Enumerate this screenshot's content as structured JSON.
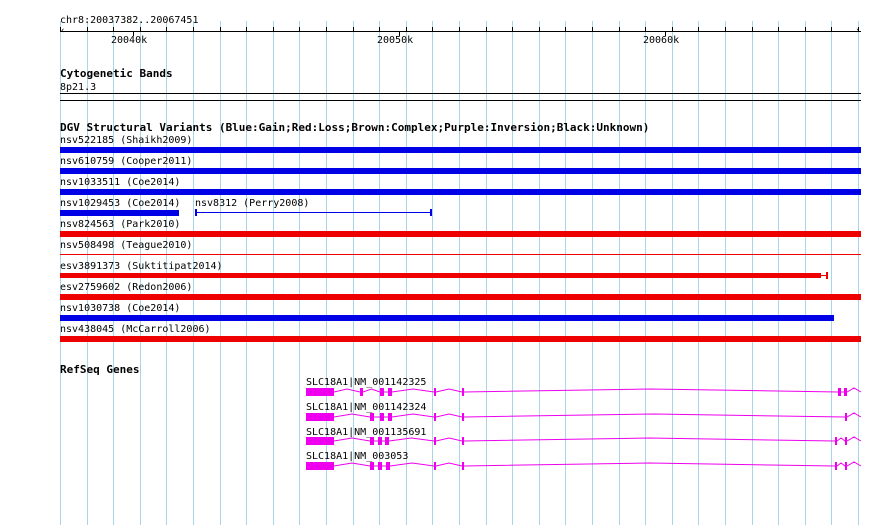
{
  "ruler": {
    "position": "chr8:20037382..20067451",
    "ticks": [
      "20040k",
      "20050k",
      "20060k"
    ]
  },
  "cytobands": {
    "title": "Cytogenetic Bands",
    "band": "8p21.3"
  },
  "dgv": {
    "title": "DGV Structural Variants (Blue:Gain;Red:Loss;Brown:Complex;Purple:Inversion;Black:Unknown)",
    "colors": {
      "gain": "#0000e6",
      "loss": "#ef0000"
    },
    "variants": [
      {
        "label": "nsv522185 (Shaikh2009)",
        "type": "gain"
      },
      {
        "label": "nsv610759 (Cooper2011)",
        "type": "gain"
      },
      {
        "label": "nsv1033511 (Coe2014)",
        "type": "gain"
      },
      {
        "label": "nsv1029453 (Coe2014)",
        "type": "gain"
      },
      {
        "label": "nsv8312 (Perry2008)",
        "type": "gain"
      },
      {
        "label": "nsv824563 (Park2010)",
        "type": "loss"
      },
      {
        "label": "nsv508498 (Teague2010)",
        "type": "loss"
      },
      {
        "label": "esv3891373 (Suktitipat2014)",
        "type": "loss"
      },
      {
        "label": "esv2759602 (Redon2006)",
        "type": "loss"
      },
      {
        "label": "nsv1030738 (Coe2014)",
        "type": "gain"
      },
      {
        "label": "nsv438045 (McCarroll2006)",
        "type": "loss"
      }
    ]
  },
  "refseq": {
    "title": "RefSeq Genes",
    "color": "#ee00ee",
    "genes": [
      {
        "label": "SLC18A1|NM_001142325"
      },
      {
        "label": "SLC18A1|NM_001142324"
      },
      {
        "label": "SLC18A1|NM_001135691"
      },
      {
        "label": "SLC18A1|NM_003053"
      }
    ]
  }
}
